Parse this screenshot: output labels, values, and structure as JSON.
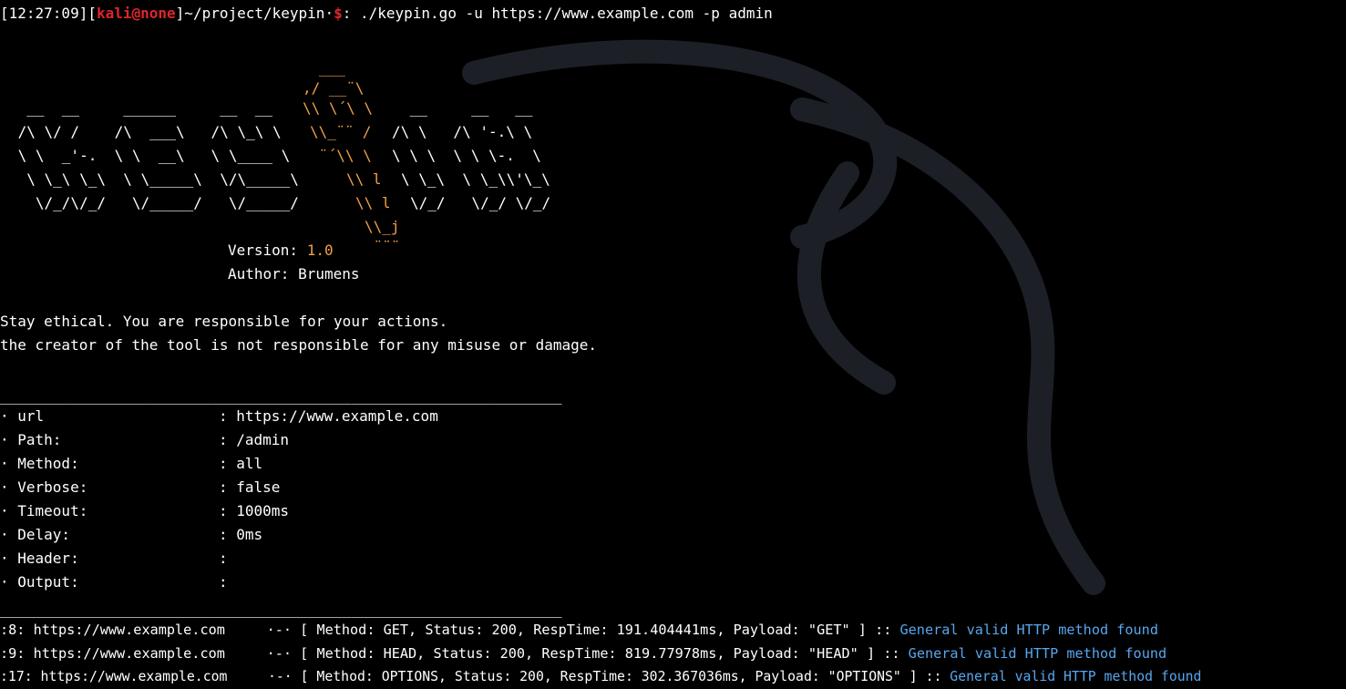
{
  "prompt": {
    "time": "[12:27:09]",
    "open_bracket": "[",
    "user_host": "kali@none",
    "path": "]~/project/keypin",
    "dot": "·",
    "dollar": "$",
    "command": ": ./keypin.go -u https://www.example.com -p admin"
  },
  "banner": {
    "left": [
      "",
      "",
      "  __  __     ______     __  __",
      " /\\ \\/ /    /\\  ___\\   /\\ \\_\\ \\",
      " \\ \\  _'-.  \\ \\  __\\   \\ \\____ \\",
      "  \\ \\_\\ \\_\\  \\ \\_____\\  \\/\\_____\\",
      "   \\/_/\\/_/   \\/_____/   \\/_____/"
    ],
    "key_art": [
      "___",
      ",/ __¨\\",
      "\\\\ \\´\\ \\",
      "\\\\_¨¨ /",
      "¨´\\\\ \\",
      "\\\\ l",
      "\\\\ l",
      "\\\\_j",
      "¨¨¨"
    ],
    "right": [
      "",
      "",
      " __     __   __",
      "/\\ \\   /\\ '-.\\ \\",
      "\\ \\ \\  \\ \\ \\-.  \\",
      "\\ \\_\\  \\ \\_\\\\'\\_\\",
      "\\/_/   \\/_/ \\/_/"
    ],
    "version_label": "Version: ",
    "version_value": "1.0",
    "author": "Author: Brumens"
  },
  "disclaimer": [
    "Stay ethical. You are responsible for your actions.",
    "the creator of the tool is not responsible for any misuse or damage."
  ],
  "separator": "________________________________________________________________",
  "config": [
    {
      "key": "· url",
      "value": ": https://www.example.com"
    },
    {
      "key": "· Path:",
      "value": ": /admin"
    },
    {
      "key": "· Method:",
      "value": ": all"
    },
    {
      "key": "· Verbose:",
      "value": ": false"
    },
    {
      "key": "· Timeout:",
      "value": ": 1000ms"
    },
    {
      "key": "· Delay:",
      "value": ": 0ms"
    },
    {
      "key": "· Header:",
      "value": ":"
    },
    {
      "key": "· Output:",
      "value": ":"
    }
  ],
  "results": [
    {
      "prefix": ":8: https://www.example.com     ·-· [ Method: GET, Status: 200, RespTime: 191.404441ms, Payload: \"GET\" ] :: ",
      "finding": "General valid HTTP method found"
    },
    {
      "prefix": ":9: https://www.example.com     ·-· [ Method: HEAD, Status: 200, RespTime: 819.77978ms, Payload: \"HEAD\" ] :: ",
      "finding": "General valid HTTP method found"
    },
    {
      "prefix": ":17: https://www.example.com     ·-· [ Method: OPTIONS, Status: 200, RespTime: 302.367036ms, Payload: \"OPTIONS\" ] :: ",
      "finding": "General valid HTTP method found"
    }
  ],
  "colors": {
    "background": "#000000",
    "text": "#ffffff",
    "user_host": "#e0242b",
    "accent_orange": "#f0a04a",
    "finding_blue": "#58a6ee"
  },
  "icons": {
    "watermark": "kali-dragon-icon"
  }
}
